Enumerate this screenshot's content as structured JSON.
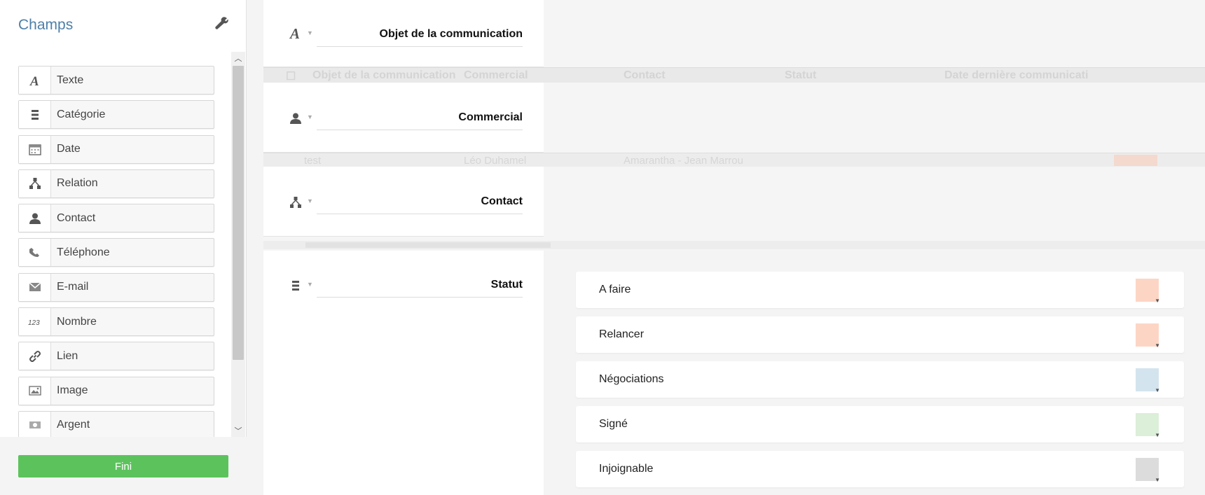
{
  "sidebar": {
    "title": "Champs",
    "fields": [
      {
        "label": "Texte",
        "icon": "text-a-icon"
      },
      {
        "label": "Catégorie",
        "icon": "list-icon"
      },
      {
        "label": "Date",
        "icon": "calendar-icon"
      },
      {
        "label": "Relation",
        "icon": "hierarchy-icon"
      },
      {
        "label": "Contact",
        "icon": "user-icon"
      },
      {
        "label": "Téléphone",
        "icon": "phone-icon"
      },
      {
        "label": "E-mail",
        "icon": "envelope-icon"
      },
      {
        "label": "Nombre",
        "icon": "number-icon"
      },
      {
        "label": "Lien",
        "icon": "link-icon"
      },
      {
        "label": "Image",
        "icon": "image-icon"
      },
      {
        "label": "Argent",
        "icon": "money-icon"
      }
    ],
    "done_label": "Fini"
  },
  "background_table": {
    "columns": [
      "Objet de la communication",
      "Commercial",
      "Contact",
      "Statut",
      "Date dernière communicati"
    ],
    "row": {
      "objet": "test",
      "commercial": "Léo Duhamel",
      "contact": "Amarantha - Jean Marrou"
    }
  },
  "panels": [
    {
      "label": "Objet de la communication",
      "icon": "text-a-icon"
    },
    {
      "label": "Commercial",
      "icon": "user-icon"
    },
    {
      "label": "Contact",
      "icon": "hierarchy-icon"
    },
    {
      "label": "Statut",
      "icon": "list-icon"
    }
  ],
  "statuses": [
    {
      "label": "A faire",
      "color": "#fdd5c5"
    },
    {
      "label": "Relancer",
      "color": "#fdd5c5"
    },
    {
      "label": "Négociations",
      "color": "#d3e4ee"
    },
    {
      "label": "Signé",
      "color": "#dcefd9"
    },
    {
      "label": "Injoignable",
      "color": "#dcdcdc"
    }
  ]
}
